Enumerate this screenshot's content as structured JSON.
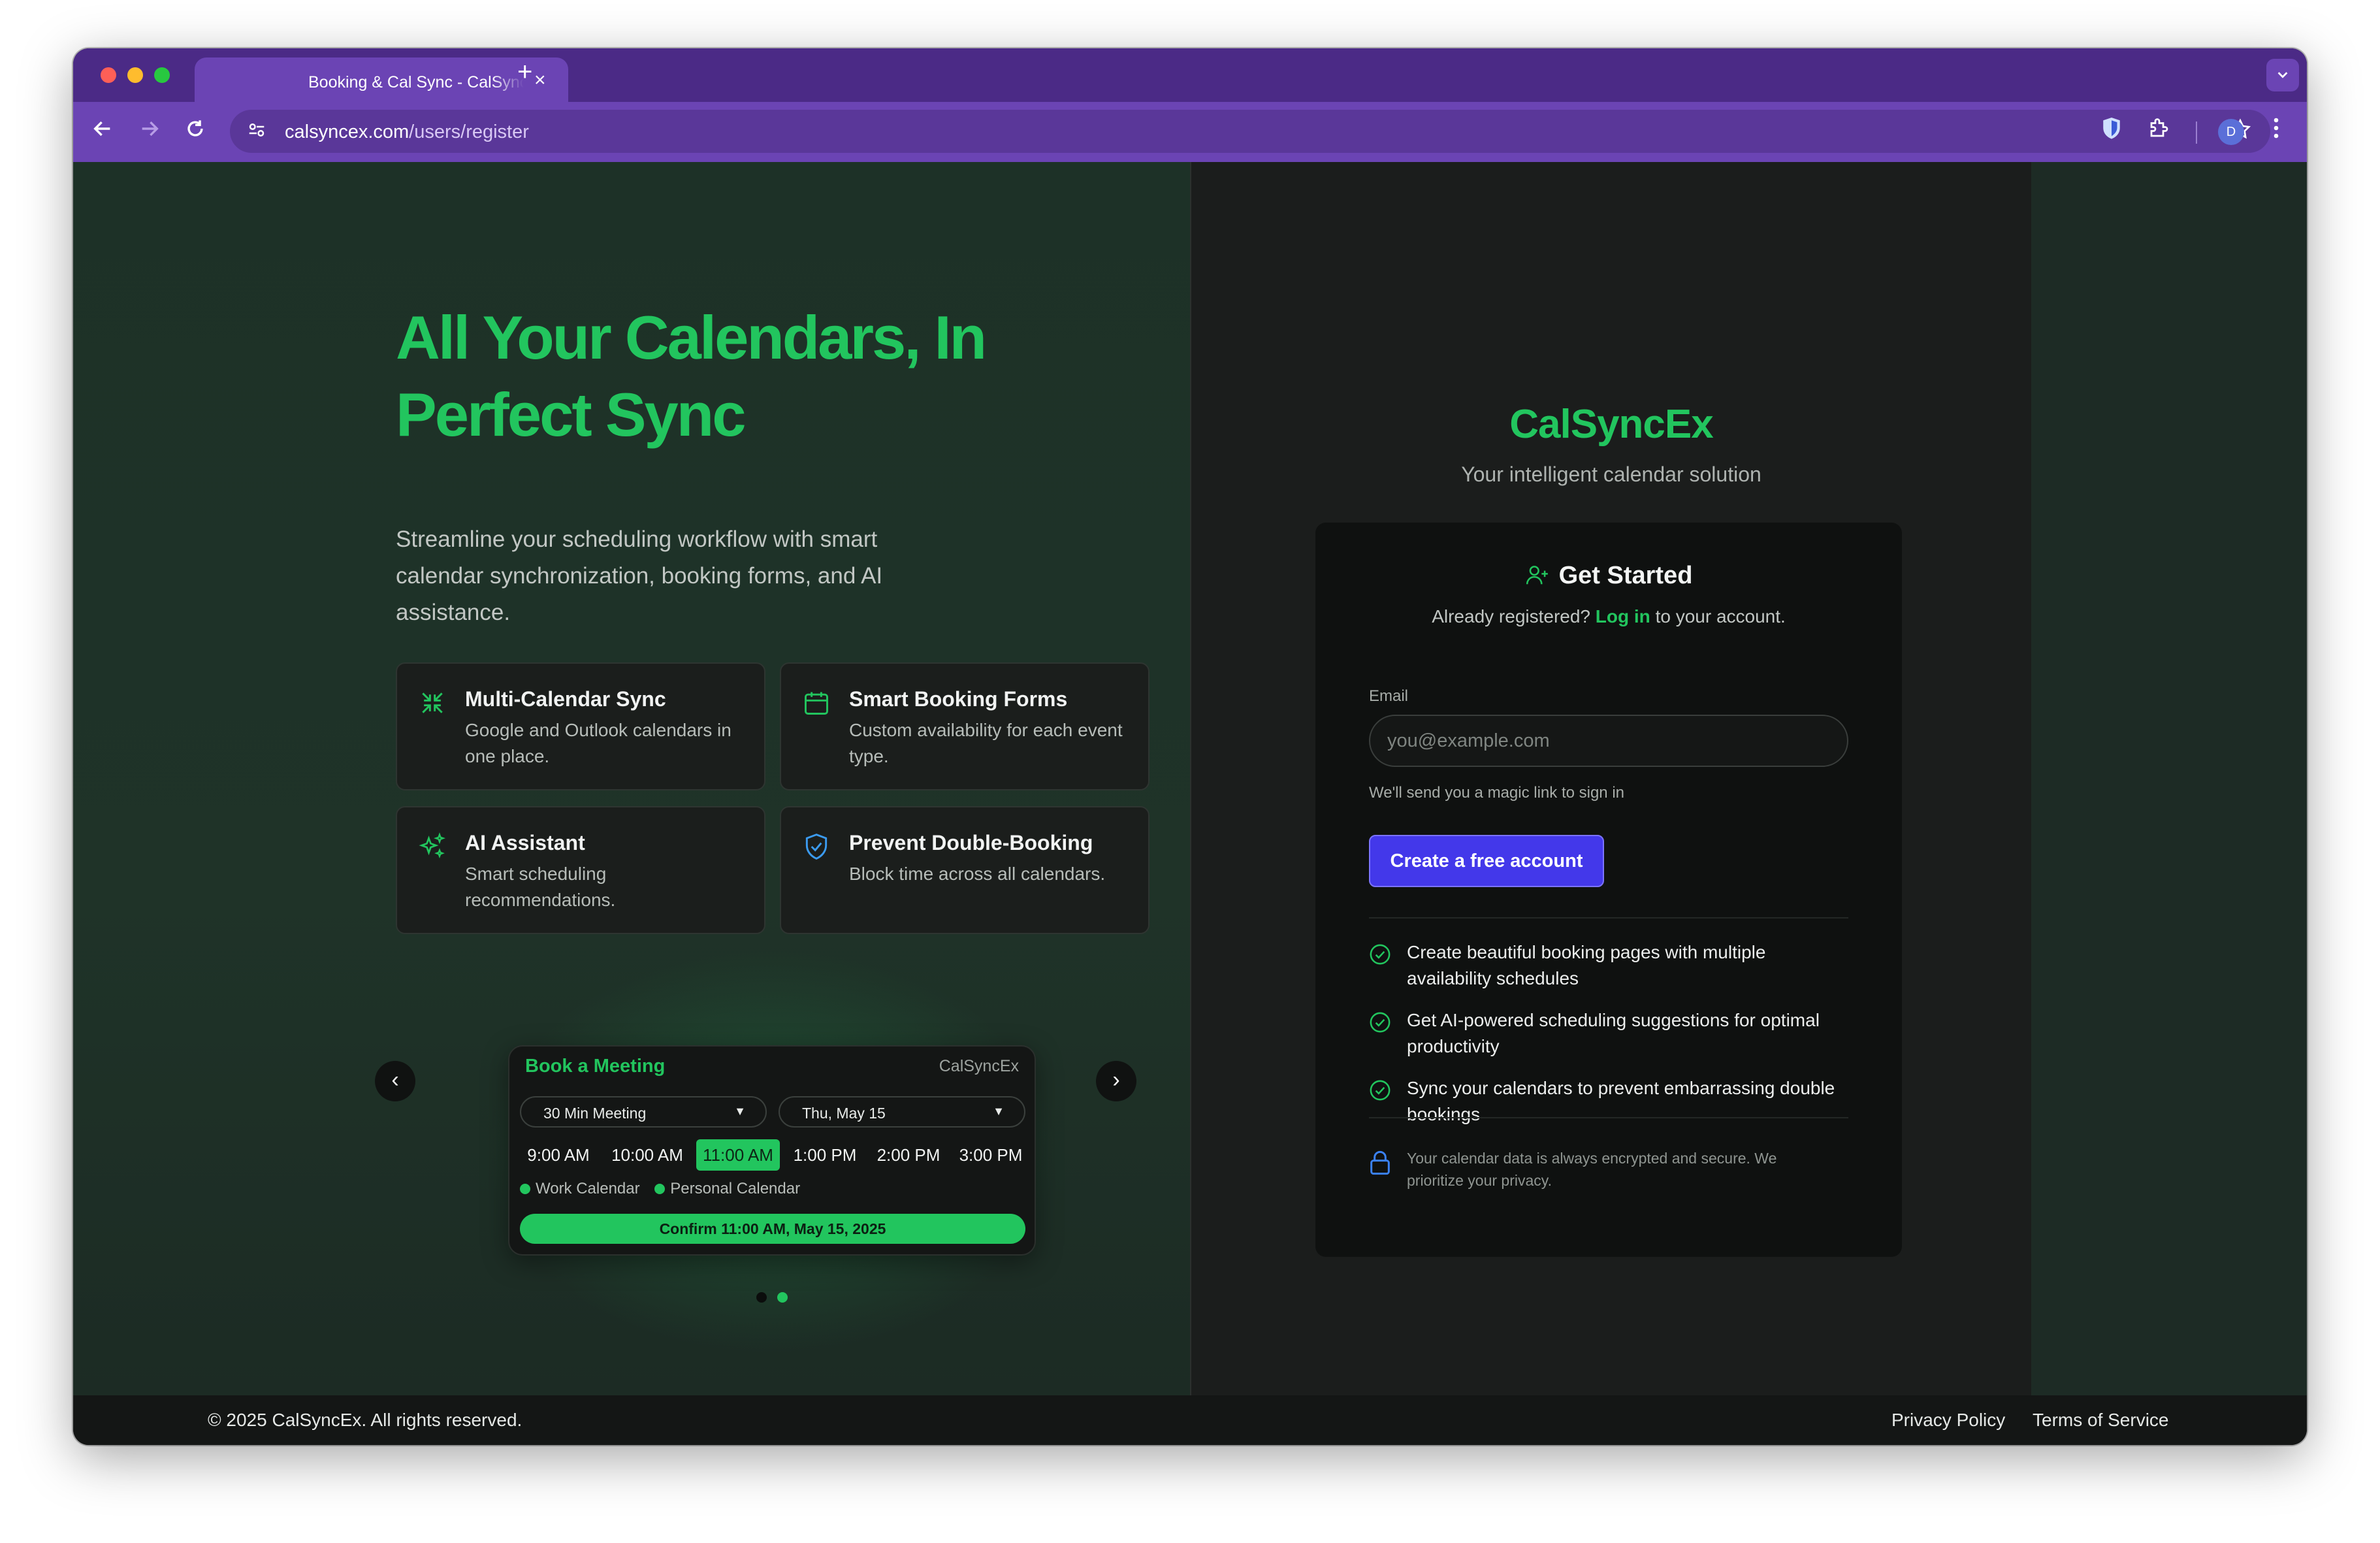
{
  "browser": {
    "tab_title": "Booking & Cal Sync - CalSyncEx",
    "tab_close": "×",
    "new_tab": "+",
    "url_domain": "calsyncex.com",
    "url_path": "/users/register",
    "profile_initial": "D"
  },
  "hero": {
    "title": "All Your Calendars, In Perfect Sync",
    "subtitle": "Streamline your scheduling workflow with smart calendar synchronization, booking forms, and AI assistance."
  },
  "features": [
    {
      "title": "Multi-Calendar Sync",
      "desc": "Google and Outlook calendars in one place.",
      "icon": "collapse-arrows-icon"
    },
    {
      "title": "Smart Booking Forms",
      "desc": "Custom availability for each event type.",
      "icon": "calendar-icon"
    },
    {
      "title": "AI Assistant",
      "desc": "Smart scheduling recommendations.",
      "icon": "sparkles-icon"
    },
    {
      "title": "Prevent Double-Booking",
      "desc": "Block time across all calendars.",
      "icon": "shield-check-icon"
    }
  ],
  "widget": {
    "title": "Book a Meeting",
    "brand": "CalSyncEx",
    "meeting_type": "30 Min Meeting",
    "date": "Thu, May 15",
    "slots": [
      "9:00 AM",
      "10:00 AM",
      "11:00 AM",
      "1:00 PM",
      "2:00 PM",
      "3:00 PM"
    ],
    "selected_slot": "11:00 AM",
    "legend": [
      "Work Calendar",
      "Personal Calendar"
    ],
    "confirm": "Confirm 11:00 AM, May 15, 2025",
    "prev": "‹",
    "next": "›"
  },
  "register": {
    "brand": "CalSyncEx",
    "tagline": "Your intelligent calendar solution",
    "title": "Get Started",
    "sub_prefix": "Already registered?",
    "login_link": "Log in",
    "sub_suffix": "to your account.",
    "email_label": "Email",
    "email_placeholder": "you@example.com",
    "email_help": "We'll send you a magic link to sign in",
    "submit": "Create a free account",
    "benefits": [
      "Create beautiful booking pages with multiple availability schedules",
      "Get AI-powered scheduling suggestions for optimal productivity",
      "Sync your calendars to prevent embarrassing double bookings"
    ],
    "security_note": "Your calendar data is always encrypted and secure. We prioritize your privacy."
  },
  "footer": {
    "copyright": "© 2025 CalSyncEx. All rights reserved.",
    "privacy": "Privacy Policy",
    "terms": "Terms of Service"
  },
  "colors": {
    "accent_green": "#22c55e",
    "primary_button": "#4338ea",
    "browser_frame": "#6b44b4"
  }
}
